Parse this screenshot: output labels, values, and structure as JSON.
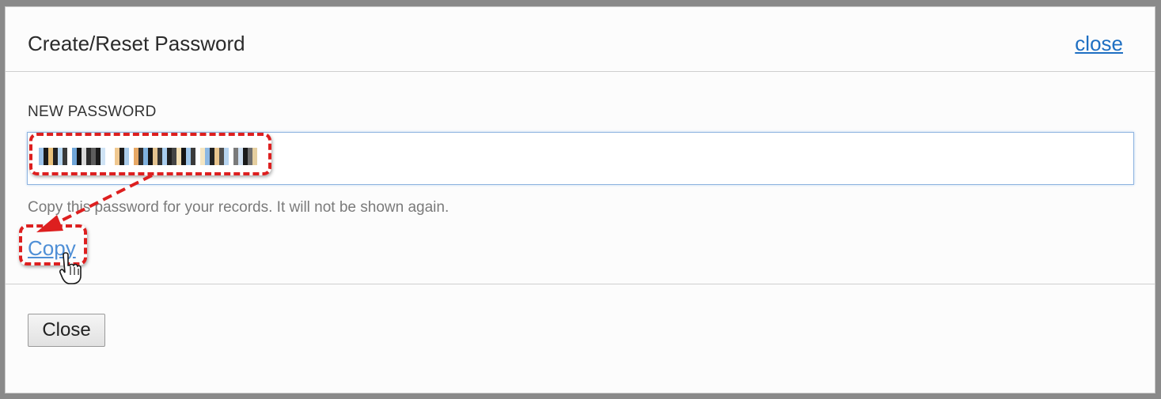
{
  "dialog": {
    "title": "Create/Reset Password",
    "close_link": "close",
    "field_label": "NEW PASSWORD",
    "hint": "Copy this password for your records. It will not be shown again.",
    "copy_link": "Copy",
    "close_button": "Close"
  },
  "annotations": {
    "highlight_color": "#dd1f1f",
    "icons": [
      "hand-pointer-cursor-icon",
      "arrow-icon"
    ]
  },
  "colors": {
    "link": "#1e6fc2",
    "copy_link": "#4f8fd6",
    "hint_text": "#7a7a7a"
  }
}
